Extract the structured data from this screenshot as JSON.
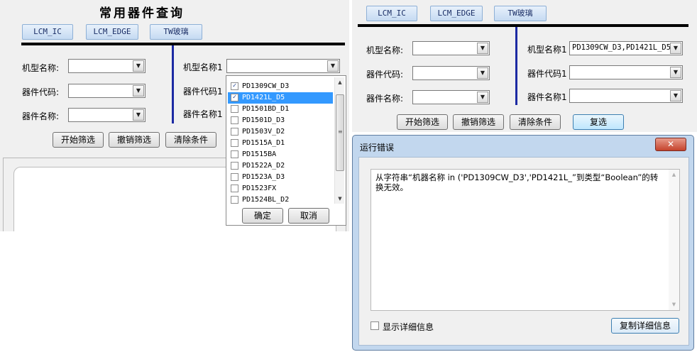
{
  "left": {
    "title": "常用器件查询",
    "tabs": [
      "LCM_IC",
      "LCM_EDGE",
      "TW玻璃"
    ],
    "filters_left": [
      {
        "label": "机型名称:",
        "value": ""
      },
      {
        "label": "器件代码:",
        "value": ""
      },
      {
        "label": "器件名称:",
        "value": ""
      }
    ],
    "filters_right": [
      {
        "label": "机型名称1",
        "value": ""
      },
      {
        "label": "器件代码1"
      },
      {
        "label": "器件名称1"
      }
    ],
    "buttons": [
      "开始筛选",
      "撤销筛选",
      "清除条件"
    ],
    "dropdown": {
      "items": [
        {
          "label": "PD1309CW_D3",
          "checked": true,
          "selected": false
        },
        {
          "label": "PD1421L_D5",
          "checked": true,
          "selected": true
        },
        {
          "label": "PD1501BD_D1",
          "checked": false,
          "selected": false
        },
        {
          "label": "PD1501D_D3",
          "checked": false,
          "selected": false
        },
        {
          "label": "PD1503V_D2",
          "checked": false,
          "selected": false
        },
        {
          "label": "PD1515A_D1",
          "checked": false,
          "selected": false
        },
        {
          "label": "PD1515BA",
          "checked": false,
          "selected": false
        },
        {
          "label": "PD1522A_D2",
          "checked": false,
          "selected": false
        },
        {
          "label": "PD1523A_D3",
          "checked": false,
          "selected": false
        },
        {
          "label": "PD1523FX",
          "checked": false,
          "selected": false
        },
        {
          "label": "PD1524BL_D2",
          "checked": false,
          "selected": false
        }
      ],
      "ok_label": "确定",
      "cancel_label": "取消"
    }
  },
  "right": {
    "tabs": [
      "LCM_IC",
      "LCM_EDGE",
      "TW玻璃"
    ],
    "filters_left": [
      {
        "label": "机型名称:",
        "value": ""
      },
      {
        "label": "器件代码:",
        "value": ""
      },
      {
        "label": "器件名称:",
        "value": ""
      }
    ],
    "filters_right": [
      {
        "label": "机型名称1",
        "value": "PD1309CW_D3,PD1421L_D5"
      },
      {
        "label": "器件代码1",
        "value": ""
      },
      {
        "label": "器件名称1",
        "value": ""
      }
    ],
    "buttons": [
      "开始筛选",
      "撤销筛选",
      "清除条件",
      "复选"
    ]
  },
  "dialog": {
    "title": "运行错误",
    "close_glyph": "✕",
    "message": "从字符串“机器名称 in ('PD1309CW_D3','PD1421L_”到类型“Boolean”的转换无效。",
    "show_details_label": "显示详细信息",
    "copy_details_label": "复制详细信息"
  },
  "icons": {
    "combo_arrow": "▼",
    "check_mark": "✓",
    "scroll_up": "▲",
    "scroll_down": "▼",
    "grip": "≡"
  }
}
